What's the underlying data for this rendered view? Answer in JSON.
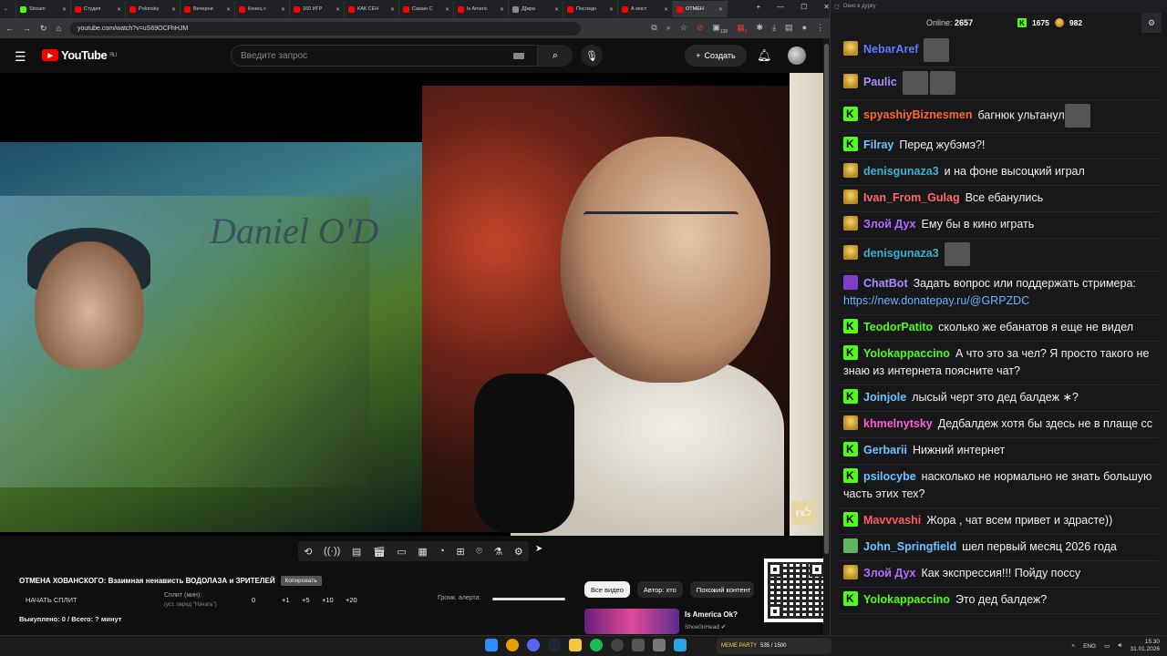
{
  "browser": {
    "tabs": [
      {
        "label": "Stream",
        "color": "#53fc18"
      },
      {
        "label": "Студия",
        "color": "#ff0000"
      },
      {
        "label": "Polonsky",
        "color": "#ff0000"
      },
      {
        "label": "Вечерни",
        "color": "#ff0000"
      },
      {
        "label": "Конец с",
        "color": "#ff0000"
      },
      {
        "label": "160 ИГР",
        "color": "#ff0000"
      },
      {
        "label": "КАК СЕН",
        "color": "#ff0000"
      },
      {
        "label": "Самая С",
        "color": "#ff0000"
      },
      {
        "label": "Is Americ",
        "color": "#ff0000"
      },
      {
        "label": "Д[жра",
        "color": "#888888"
      },
      {
        "label": "Последн",
        "color": "#ff0000"
      },
      {
        "label": "А мост",
        "color": "#ff0000"
      },
      {
        "label": "ОТМЕН",
        "color": "#ff0000"
      }
    ],
    "url": "youtube.com/watch?v=uS69OCFhHJM",
    "ext_badges": {
      "a": "138",
      "b": "0"
    }
  },
  "youtube": {
    "logo_text": "YouTube",
    "region": "RU",
    "search_placeholder": "Введите запрос",
    "create_label": "Создать"
  },
  "video_overlay": {
    "album_text": "Daniel O'D"
  },
  "plugin": {
    "video_title": "ОТМЕНА ХОВАНСКОГО: Взаимная ненависть ВОДОЛАЗА и ЗРИТЕЛЕЙ",
    "sub_button": "Копировать",
    "split_button": "НАЧАТЬ СПЛИТ",
    "split_label": "Сплит (мин):",
    "split_hint": "(уст. перед \"Начать\")",
    "split_values": [
      "0",
      "+1",
      "+5",
      "+10",
      "+20"
    ],
    "alert_label": "Громк. алерта:",
    "bought_text": "Выкуплено: 0 / Всего: ? минут"
  },
  "related": {
    "chips": [
      "Все видео",
      "Автор: хто",
      "Похожий контент"
    ],
    "title": "Is America Ok?",
    "channel": "Shoe0nHead"
  },
  "chat": {
    "window_title": "Окно в дурку",
    "online_label": "Online:",
    "online_count": "2657",
    "kick_count": "1675",
    "gold_count": "982",
    "messages": [
      {
        "user": "NebarAref",
        "color": "#5b7cff",
        "badge": "gold",
        "text": "",
        "emotes": 1
      },
      {
        "user": "Paulic",
        "color": "#a98cff",
        "badge": "gold",
        "text": "",
        "emotes": 2
      },
      {
        "user": "spyashiyBiznesmen",
        "color": "#ff6a2a",
        "badge": "kick",
        "text": "багнюк ультанул",
        "emotes": 1
      },
      {
        "user": "Filray",
        "color": "#6fc3ff",
        "badge": "kick",
        "text": "Перед жубэмэ?!",
        "emotes": 0
      },
      {
        "user": "denisgunaza3",
        "color": "#38b2d4",
        "badge": "gold",
        "text": "и на фоне высоцкий играл",
        "emotes": 0
      },
      {
        "user": "Ivan_From_Gulag",
        "color": "#ff6a6a",
        "badge": "gold",
        "text": "Все ебанулись",
        "emotes": 0
      },
      {
        "user": "Злой Дух",
        "color": "#b36bff",
        "badge": "gold",
        "text": "Ему бы в кино играть",
        "emotes": 0
      },
      {
        "user": "denisgunaza3",
        "color": "#38b2d4",
        "badge": "gold",
        "text": "",
        "emotes": 1
      },
      {
        "user": "ChatBot",
        "color": "#a98cff",
        "badge": "bot",
        "text": "Задать вопрос или поддержать стримера: ",
        "link": "https://new.donatepay.ru/@GRPZDC",
        "emotes": 0
      },
      {
        "user": "TeodorPatito",
        "color": "#53fc18",
        "badge": "kick",
        "text": "сколько же ебанатов я еще не видел",
        "emotes": 0
      },
      {
        "user": "Yolokappaccino",
        "color": "#53fc18",
        "badge": "kick",
        "text": "А что это за чел? Я просто такого не знаю из интернета поясните чат?",
        "emotes": 0
      },
      {
        "user": "Joinjole",
        "color": "#6fc3ff",
        "badge": "kick",
        "text": "лысый черт это дед балдеж ∗?",
        "emotes": 0
      },
      {
        "user": "khmelnytsky",
        "color": "#ff5fd2",
        "badge": "gold",
        "text": "Дедбалдеж хотя бы здесь не в плаще сс",
        "emotes": 0
      },
      {
        "user": "Gerbarii",
        "color": "#6fc3ff",
        "badge": "kick",
        "text": "Нижний интернет",
        "emotes": 0
      },
      {
        "user": "psilocybe",
        "color": "#6fc3ff",
        "badge": "kick",
        "text": "насколько не нормально не знать большую часть этих тех?",
        "emotes": 0
      },
      {
        "user": "Mavvvashi",
        "color": "#ff5a5a",
        "badge": "kick",
        "text": "Жора , чат всем привет и здрасте))",
        "emotes": 0
      },
      {
        "user": "John_Springfield",
        "color": "#6fc3ff",
        "badge": "check",
        "text": "шел первый месяц 2026 года",
        "emotes": 0
      },
      {
        "user": "Злой Дух",
        "color": "#b36bff",
        "badge": "gold",
        "text": "Как экспрессия!!! Пойду поссу",
        "emotes": 0
      },
      {
        "user": "Yolokappaccino",
        "color": "#53fc18",
        "badge": "kick",
        "text": "Это дед балдеж?",
        "emotes": 0
      }
    ]
  },
  "taskbar": {
    "widget_text": "MEME PARTY",
    "widget_count": "535 / 1500",
    "lang": "ENG",
    "time": "15:30",
    "date": "31.01.2026"
  }
}
